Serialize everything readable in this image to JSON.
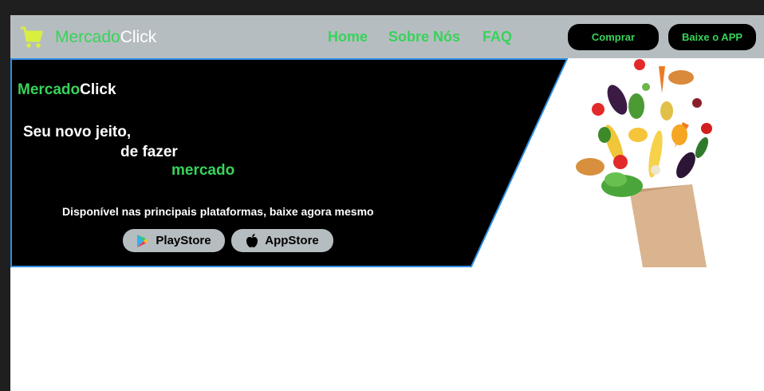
{
  "navbar": {
    "brand_green": "Mercado",
    "brand_white": "Click",
    "links": [
      "Home",
      "Sobre Nós",
      "FAQ"
    ],
    "buttons": {
      "comprar": "Comprar",
      "baixe": "Baixe o APP"
    }
  },
  "hero": {
    "brand_green": "Mercado",
    "brand_white": "Click",
    "tagline_1": "Seu novo jeito,",
    "tagline_2": "de fazer",
    "tagline_3": "mercado",
    "available_text": "Disponível nas principais plataformas, baixe agora mesmo",
    "stores": {
      "play": "PlayStore",
      "app": "AppStore"
    },
    "image": "grocery-bag-with-vegetables"
  },
  "icons": {
    "cart": "shopping-cart-icon",
    "play": "google-play-icon",
    "apple": "apple-icon"
  },
  "colors": {
    "accent_green": "#37d35a",
    "navbar_bg": "#b6bdc0",
    "hero_bg": "#000000",
    "hero_border": "#2f8fe6"
  }
}
